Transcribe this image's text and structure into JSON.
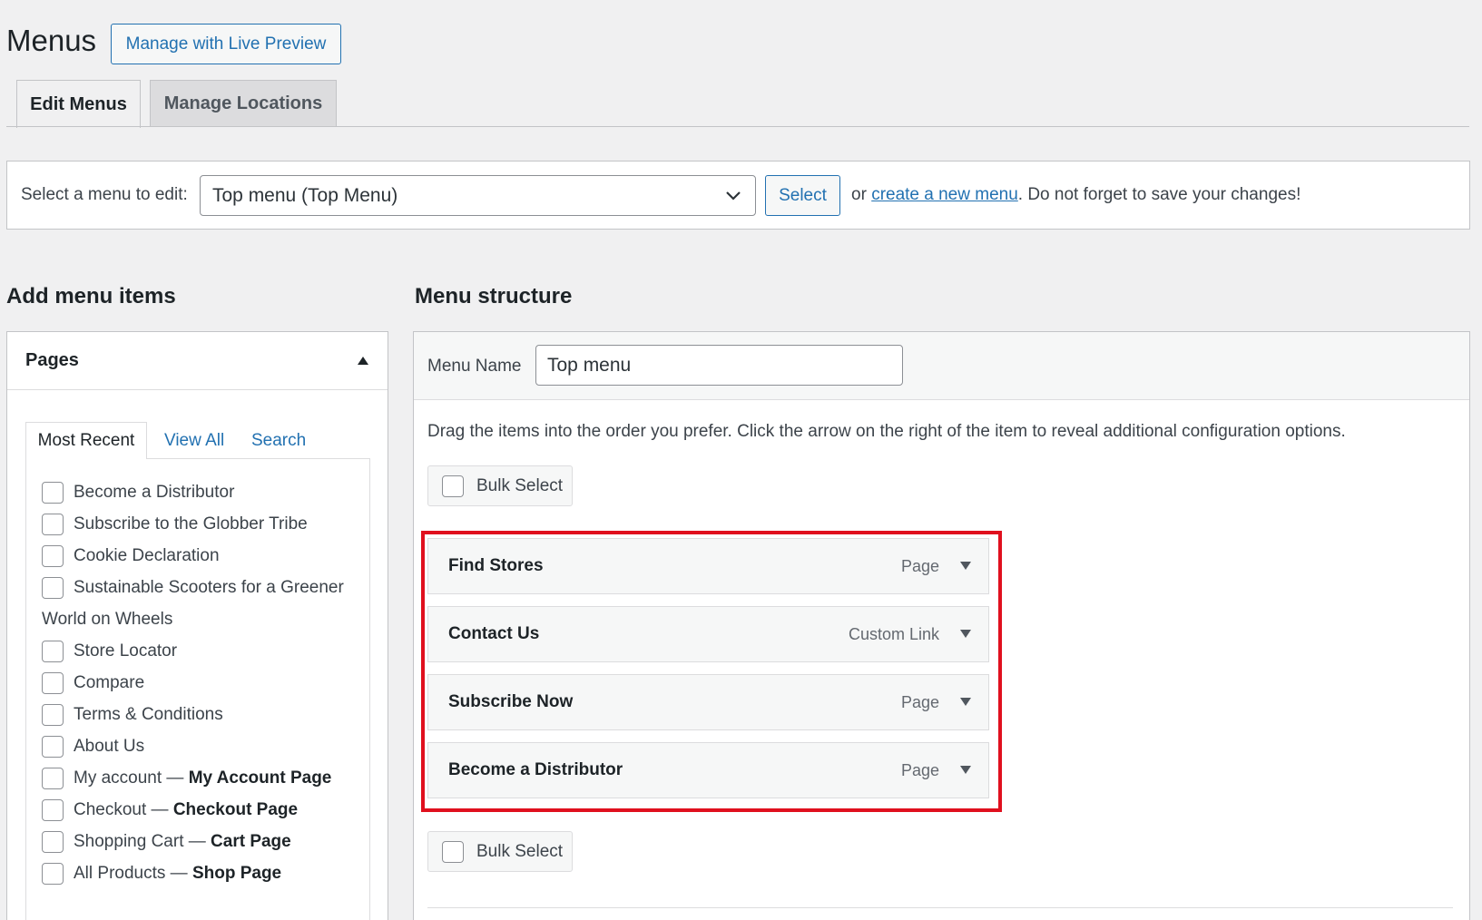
{
  "header": {
    "title": "Menus",
    "live_preview_label": "Manage with Live Preview"
  },
  "tabs": [
    {
      "label": "Edit Menus",
      "active": true
    },
    {
      "label": "Manage Locations",
      "active": false
    }
  ],
  "select_menu": {
    "label": "Select a menu to edit:",
    "selected": "Top menu (Top Menu)",
    "button_label": "Select",
    "hint_prefix": "or",
    "hint_link": "create a new menu",
    "hint_suffix": ". Do not forget to save your changes!"
  },
  "add_menu_items": {
    "heading": "Add menu items",
    "panel_title": "Pages",
    "subtabs": [
      "Most Recent",
      "View All",
      "Search"
    ],
    "pages": [
      {
        "label": "Become a Distributor"
      },
      {
        "label": "Subscribe to the Globber Tribe"
      },
      {
        "label": "Cookie Declaration"
      },
      {
        "label": "Sustainable Scooters for a Greener",
        "continuation": "World on Wheels"
      },
      {
        "label": "Store Locator"
      },
      {
        "label": "Compare"
      },
      {
        "label": "Terms & Conditions"
      },
      {
        "label": "About Us"
      },
      {
        "label": "My account —",
        "strong": "My Account Page"
      },
      {
        "label": "Checkout —",
        "strong": "Checkout Page"
      },
      {
        "label": "Shopping Cart —",
        "strong": "Cart Page"
      },
      {
        "label": "All Products —",
        "strong": "Shop Page"
      }
    ]
  },
  "menu_structure": {
    "heading": "Menu structure",
    "menu_name_label": "Menu Name",
    "menu_name_value": "Top menu",
    "drag_hint": "Drag the items into the order you prefer. Click the arrow on the right of the item to reveal additional configuration options.",
    "bulk_select_label": "Bulk Select",
    "items": [
      {
        "title": "Find Stores",
        "type": "Page"
      },
      {
        "title": "Contact Us",
        "type": "Custom Link"
      },
      {
        "title": "Subscribe Now",
        "type": "Page"
      },
      {
        "title": "Become a Distributor",
        "type": "Page"
      }
    ]
  },
  "colors": {
    "accent": "#2271b1",
    "highlight": "#e0101e"
  }
}
